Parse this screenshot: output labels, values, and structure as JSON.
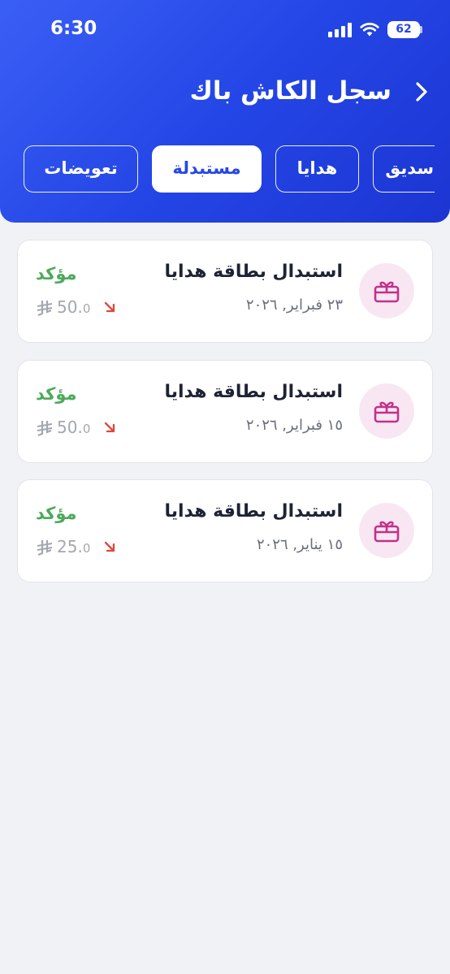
{
  "status_bar": {
    "time": "6:30",
    "battery": "62"
  },
  "header": {
    "title": "سجل الكاش باك"
  },
  "tabs": [
    {
      "label": "تعويضات",
      "active": false
    },
    {
      "label": "مستبدلة",
      "active": true
    },
    {
      "label": "هدايا",
      "active": false
    },
    {
      "label": "سديق",
      "active": false
    }
  ],
  "items": [
    {
      "title": "استبدال بطاقة هدايا",
      "date": "٢٣ فبراير, ٢٠٢٦",
      "status": "مؤكد",
      "amount_main": "50.",
      "amount_decimal": "0",
      "icon": "gift-icon"
    },
    {
      "title": "استبدال بطاقة هدايا",
      "date": "١٥ فبراير, ٢٠٢٦",
      "status": "مؤكد",
      "amount_main": "50.",
      "amount_decimal": "0",
      "icon": "gift-icon"
    },
    {
      "title": "استبدال بطاقة هدايا",
      "date": "١٥ يناير, ٢٠٢٦",
      "status": "مؤكد",
      "amount_main": "25.",
      "amount_decimal": "0",
      "icon": "gift-icon"
    }
  ],
  "colors": {
    "header_gradient_start": "#3a5ff5",
    "header_gradient_end": "#1c35d2",
    "status_confirmed": "#4caa5a",
    "gift_icon": "#c2318a",
    "arrow_down": "#e0473d",
    "amount_text": "#a3a7b0"
  }
}
